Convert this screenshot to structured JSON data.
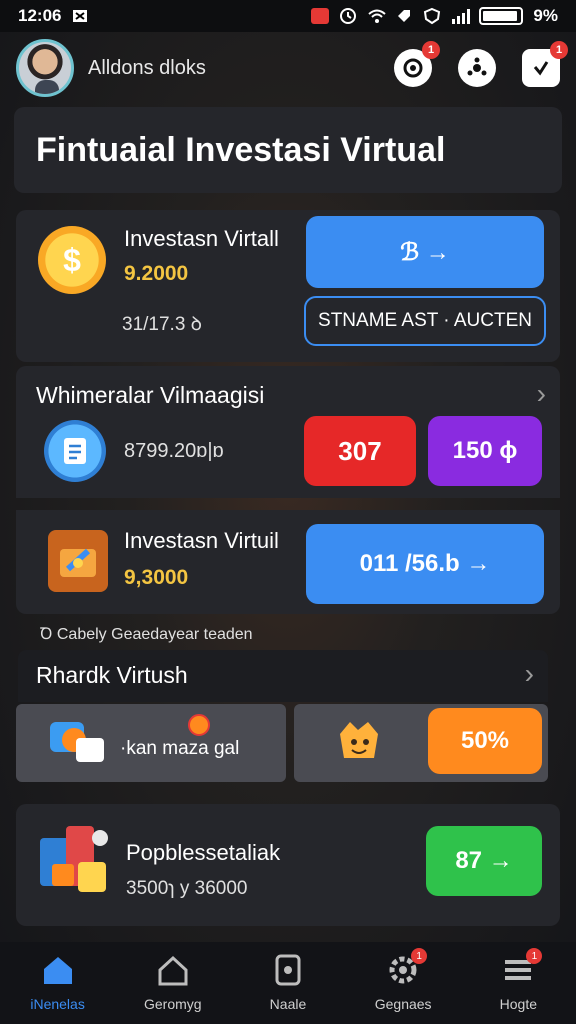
{
  "status_bar": {
    "time": "12:06",
    "battery": "9%"
  },
  "header": {
    "username": "Alldons dloks"
  },
  "header_badges": {
    "notif": "1",
    "wallet": "1"
  },
  "page_title": "Fintuaial Investasi Virtual",
  "invest_card_1": {
    "label": "Investasn Virtall",
    "amount": "9.2000",
    "sub": "31/17.3 ꝺ",
    "primary_button": "ℬ →",
    "secondary_button": "STNAME AST · AUCTEN"
  },
  "section_market": {
    "title": "Whimeralar Vilmaagisi",
    "value": "8799.20ɒ|ɒ",
    "red_button": "307",
    "purple_button": "150 ɸ"
  },
  "invest_card_2": {
    "label": "Investasn Virtuil",
    "amount": "9,3000",
    "button": "011 /56.b →"
  },
  "caption": "Ꝺ Cabely Geaedayear teaden",
  "section_rank": {
    "title": "Rhardk Virtush",
    "left_label": "·kan maza gal",
    "right_button": "50%"
  },
  "product_card": {
    "label": "Popblessetaliak",
    "sub": "3500ɿ y 36000",
    "button": "87 →"
  },
  "bottom_nav": [
    {
      "label": "iNenelas",
      "icon": "home-icon"
    },
    {
      "label": "Geromyg",
      "icon": "house-outline-icon"
    },
    {
      "label": "Naale",
      "icon": "wallet-icon"
    },
    {
      "label": "Gegnaes",
      "icon": "gear-icon",
      "badge": "1"
    },
    {
      "label": "Hogte",
      "icon": "menu-icon",
      "badge": "1"
    }
  ],
  "colors": {
    "accent": "#3b8df2",
    "gold": "#f4c542",
    "card": "#25262b"
  }
}
